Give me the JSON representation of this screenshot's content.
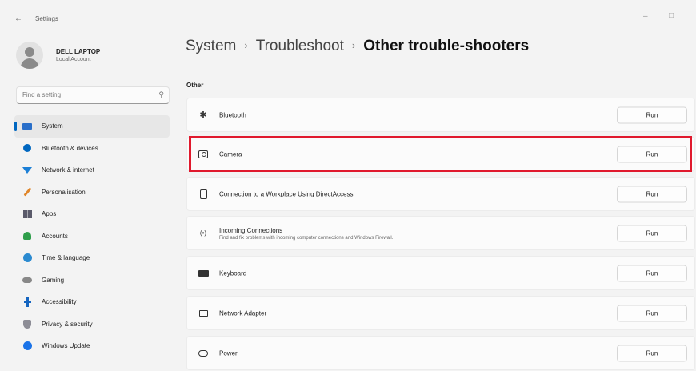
{
  "window": {
    "title": "Settings",
    "back_icon": "arrow-left-icon",
    "minimize_glyph": "–",
    "maximize_glyph": "□"
  },
  "profile": {
    "name": "DELL LAPTOP",
    "account_type": "Local Account"
  },
  "search": {
    "placeholder": "Find a setting",
    "icon": "search-icon"
  },
  "sidebar": {
    "items": [
      {
        "label": "System",
        "icon": "system-icon",
        "active": true
      },
      {
        "label": "Bluetooth & devices",
        "icon": "bluetooth-icon"
      },
      {
        "label": "Network & internet",
        "icon": "network-icon"
      },
      {
        "label": "Personalisation",
        "icon": "personalisation-icon"
      },
      {
        "label": "Apps",
        "icon": "apps-icon"
      },
      {
        "label": "Accounts",
        "icon": "accounts-icon"
      },
      {
        "label": "Time & language",
        "icon": "time-language-icon"
      },
      {
        "label": "Gaming",
        "icon": "gaming-icon"
      },
      {
        "label": "Accessibility",
        "icon": "accessibility-icon"
      },
      {
        "label": "Privacy & security",
        "icon": "privacy-icon"
      },
      {
        "label": "Windows Update",
        "icon": "windows-update-icon"
      }
    ]
  },
  "breadcrumb": {
    "items": [
      "System",
      "Troubleshoot",
      "Other trouble-shooters"
    ],
    "separator": "›"
  },
  "section": {
    "label": "Other"
  },
  "troubleshooters": [
    {
      "title": "Bluetooth",
      "icon": "bluetooth-icon",
      "run_label": "Run"
    },
    {
      "title": "Camera",
      "icon": "camera-icon",
      "run_label": "Run",
      "highlighted": true
    },
    {
      "title": "Connection to a Workplace Using DirectAccess",
      "icon": "phone-icon",
      "run_label": "Run"
    },
    {
      "title": "Incoming Connections",
      "description": "Find and fix problems with incoming computer connections and Windows Firewall.",
      "icon": "antenna-icon",
      "run_label": "Run"
    },
    {
      "title": "Keyboard",
      "icon": "keyboard-icon",
      "run_label": "Run"
    },
    {
      "title": "Network Adapter",
      "icon": "network-adapter-icon",
      "run_label": "Run"
    },
    {
      "title": "Power",
      "icon": "power-icon",
      "run_label": "Run"
    }
  ],
  "colors": {
    "accent": "#0067c0",
    "highlight_box": "#e0192d",
    "background": "#f3f3f3",
    "card": "#fbfbfb"
  }
}
